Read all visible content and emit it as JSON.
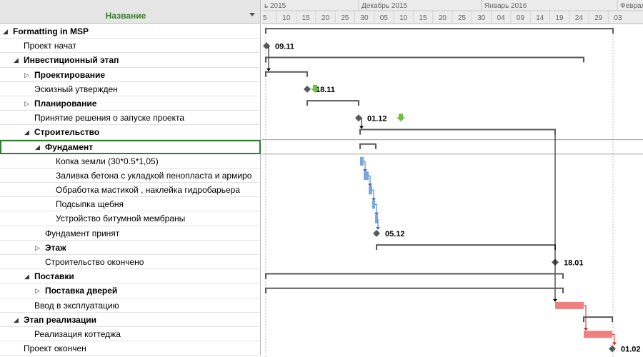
{
  "header": {
    "name_column": "Название"
  },
  "timeline": {
    "months": [
      {
        "label": "ь 2015"
      },
      {
        "label": "Декабрь 2015"
      },
      {
        "label": "Январь 2016"
      },
      {
        "label": "Февраль"
      }
    ],
    "days": [
      "5",
      "10",
      "15",
      "20",
      "25",
      "30",
      "05",
      "10",
      "15",
      "20",
      "25",
      "30",
      "04",
      "09",
      "14",
      "19",
      "24",
      "29",
      "03"
    ]
  },
  "tasks": [
    {
      "label": "Formatting in MSP",
      "level": 0,
      "toggle": "expanded",
      "bold": true
    },
    {
      "label": "Проект начат",
      "level": 1,
      "toggle": "none",
      "bold": false,
      "milestone": "09.11"
    },
    {
      "label": "Инвестиционный этап",
      "level": 1,
      "toggle": "expanded",
      "bold": true
    },
    {
      "label": "Проектирование",
      "level": 2,
      "toggle": "collapsed",
      "bold": true
    },
    {
      "label": "Эскизный утвержден",
      "level": 2,
      "toggle": "none",
      "bold": false,
      "milestone": "18.11"
    },
    {
      "label": "Планирование",
      "level": 2,
      "toggle": "collapsed",
      "bold": true
    },
    {
      "label": "Принятие решения о запуске проекта",
      "level": 2,
      "toggle": "none",
      "bold": false,
      "milestone": "01.12"
    },
    {
      "label": "Строительство",
      "level": 2,
      "toggle": "expanded",
      "bold": true
    },
    {
      "label": "Фундамент",
      "level": 3,
      "toggle": "expanded",
      "bold": true,
      "selected": true
    },
    {
      "label": "Копка земли (30*0.5*1,05)",
      "level": 4,
      "toggle": "none",
      "bold": false
    },
    {
      "label": "Заливка бетона с укладкой пенопласта и армиро",
      "level": 4,
      "toggle": "none",
      "bold": false
    },
    {
      "label": "Обработка мастикой , наклейка гидробарьера",
      "level": 4,
      "toggle": "none",
      "bold": false
    },
    {
      "label": "Подсыпка щебня",
      "level": 4,
      "toggle": "none",
      "bold": false
    },
    {
      "label": "Устройство битумной мембраны",
      "level": 4,
      "toggle": "none",
      "bold": false
    },
    {
      "label": "Фундамент принят",
      "level": 3,
      "toggle": "none",
      "bold": false,
      "milestone": "05.12"
    },
    {
      "label": "Этаж",
      "level": 3,
      "toggle": "collapsed",
      "bold": true
    },
    {
      "label": "Строительство окончено",
      "level": 3,
      "toggle": "none",
      "bold": false,
      "milestone": "18.01"
    },
    {
      "label": "Поставки",
      "level": 2,
      "toggle": "expanded",
      "bold": true
    },
    {
      "label": "Поставка дверей",
      "level": 3,
      "toggle": "collapsed",
      "bold": true
    },
    {
      "label": "Ввод в эксплуатацию",
      "level": 2,
      "toggle": "none",
      "bold": false
    },
    {
      "label": "Этап реализации",
      "level": 1,
      "toggle": "expanded",
      "bold": true
    },
    {
      "label": "Реализация коттеджа",
      "level": 2,
      "toggle": "none",
      "bold": false
    },
    {
      "label": "Проект окончен",
      "level": 1,
      "toggle": "none",
      "bold": false,
      "milestone": "01.02"
    }
  ],
  "colors": {
    "header_text": "#3a7a2c",
    "task_bar_blue": "#7aa7e0",
    "critical_bar": "#f08080",
    "critical_link": "#d61f1f",
    "summary_bar": "#595959",
    "milestone": "#595959",
    "indicator_green": "#6fbf3a"
  }
}
